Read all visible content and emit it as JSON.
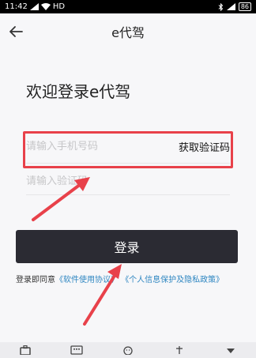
{
  "status_bar": {
    "time": "11:42",
    "network": "HD",
    "battery": "86"
  },
  "navbar": {
    "title": "e代驾"
  },
  "login": {
    "heading": "欢迎登录e代驾",
    "phone_placeholder": "请输入手机号码",
    "get_code_label": "获取验证码",
    "code_placeholder": "请输入验证码",
    "button_label": "登录"
  },
  "agreement": {
    "prefix": "登录即同意",
    "software_link": "《软件使用协议》",
    "privacy_link": "《个人信息保护及隐私政策》"
  },
  "colors": {
    "accent_red": "#e8414a",
    "button_dark": "#2b2b33",
    "link_blue": "#2e86c1"
  },
  "bottom_icons": [
    "briefcase-icon",
    "keyboard-icon",
    "emoji-icon",
    "anchor-icon",
    "down-triangle-icon"
  ]
}
